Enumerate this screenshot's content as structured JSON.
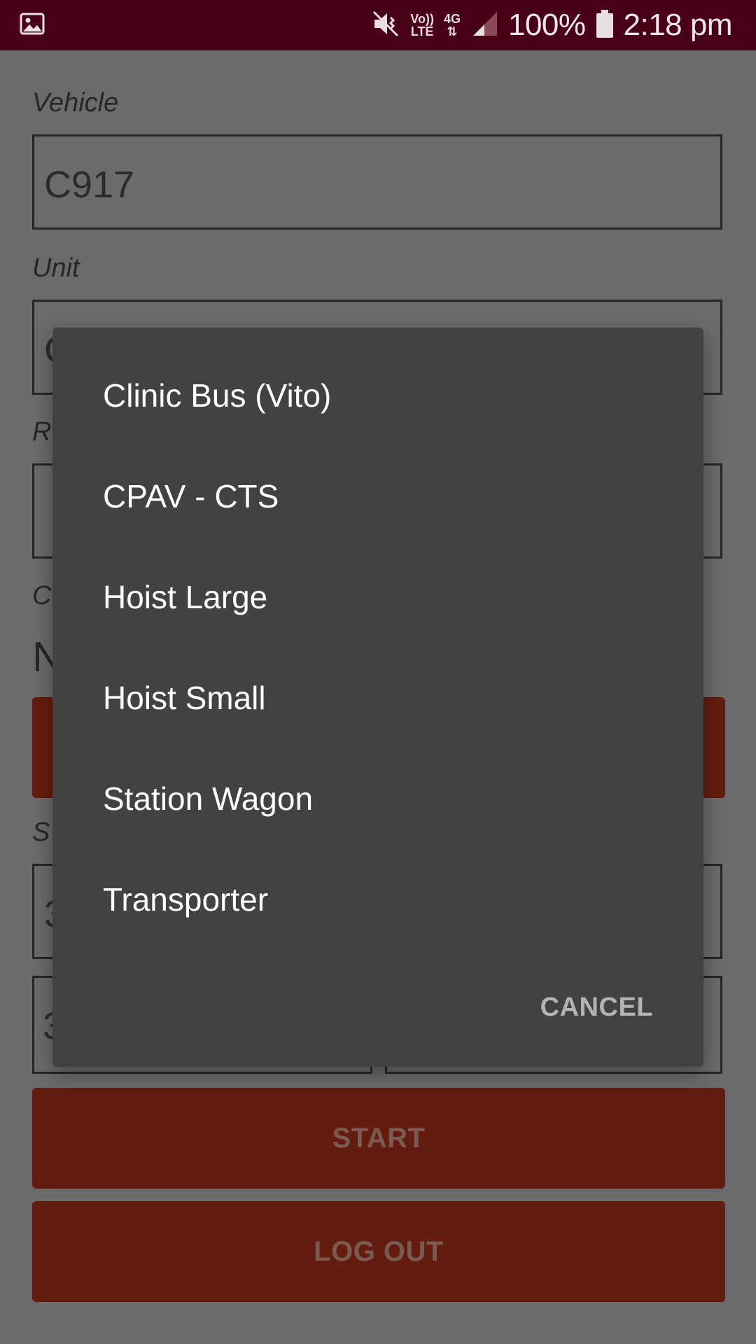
{
  "status_bar": {
    "battery": "100%",
    "time": "2:18 pm",
    "volte_top": "Vo))",
    "volte_bottom": "LTE",
    "network": "4G"
  },
  "form": {
    "vehicle_label": "Vehicle",
    "vehicle_value": "C917",
    "unit_label": "Unit",
    "unit_value_partial": "C",
    "third_label_partial": "R",
    "fourth_label_partial": "C",
    "fourth_value_partial": "N",
    "fifth_label_partial": "S",
    "start_value_partial": "3",
    "end_value_partial": "3",
    "start_button": "START",
    "logout_button": "LOG OUT"
  },
  "dialog": {
    "options": [
      "Clinic Bus (Vito)",
      "CPAV - CTS",
      "Hoist Large",
      "Hoist Small",
      "Station Wagon",
      "Transporter"
    ],
    "cancel": "CANCEL"
  }
}
